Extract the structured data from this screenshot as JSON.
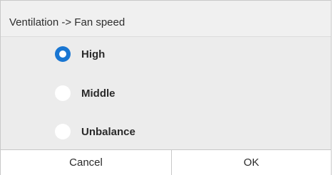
{
  "dialog": {
    "title": "Ventilation -> Fan speed",
    "options": [
      {
        "label": "High",
        "selected": true
      },
      {
        "label": "Middle",
        "selected": false
      },
      {
        "label": "Unbalance",
        "selected": false
      }
    ],
    "cancel_label": "Cancel",
    "ok_label": "OK"
  },
  "colors": {
    "accent": "#1976d2",
    "options_background": "#ececec",
    "header_background": "#f0f0f0"
  }
}
